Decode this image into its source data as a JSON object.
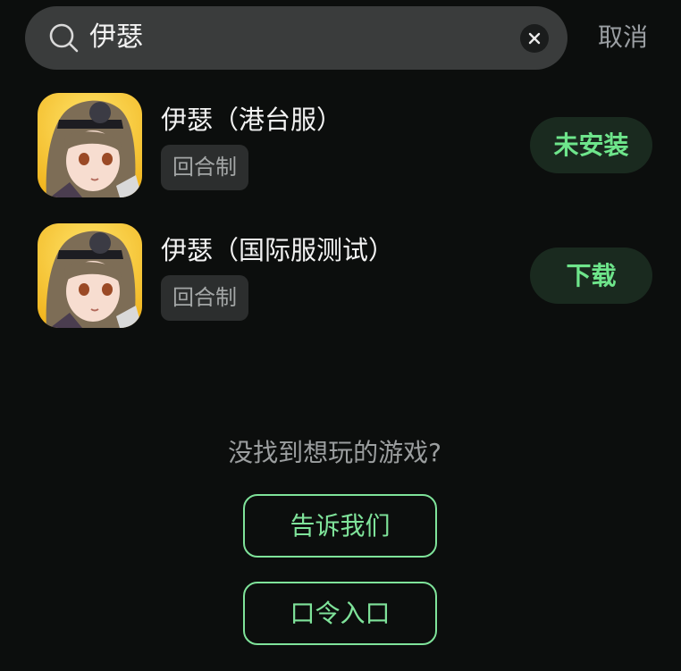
{
  "search": {
    "query": "伊瑟",
    "cancel_label": "取消"
  },
  "results": [
    {
      "title": "伊瑟（港台服）",
      "tag": "回合制",
      "action": "未安装"
    },
    {
      "title": "伊瑟（国际服测试）",
      "tag": "回合制",
      "action": "下载"
    }
  ],
  "footer": {
    "prompt": "没找到想玩的游戏?",
    "tell_us_label": "告诉我们",
    "passcode_label": "口令入口"
  },
  "colors": {
    "accent": "#6ee58b",
    "background": "#0c0e0d",
    "search_bg": "#3a3c3c"
  },
  "icons": {
    "search": "search-icon",
    "clear": "close-icon",
    "game": "game-avatar-icon"
  }
}
